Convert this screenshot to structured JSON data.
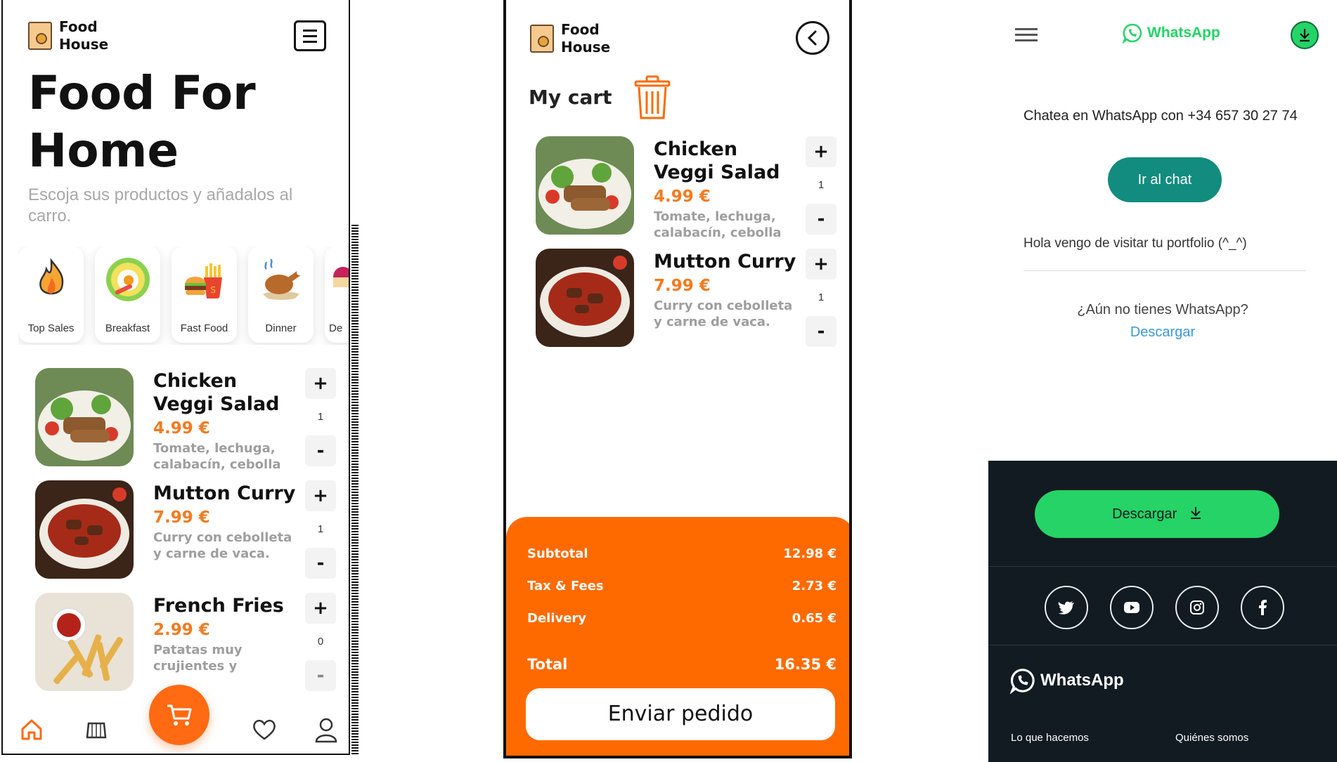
{
  "screen1": {
    "brand": {
      "line1": "Food",
      "line2": "House"
    },
    "hero": "Food For Home",
    "subtitle": "Escoja sus productos y añadalos al carro.",
    "categories": [
      {
        "label": "Top Sales",
        "icon": "fire-icon"
      },
      {
        "label": "Breakfast",
        "icon": "egg-plate-icon"
      },
      {
        "label": "Fast Food",
        "icon": "burger-fries-icon"
      },
      {
        "label": "Dinner",
        "icon": "roast-chicken-icon"
      },
      {
        "label": "De",
        "icon": "dessert-icon"
      }
    ],
    "items": [
      {
        "name": "Chicken Veggi Salad",
        "price": "4.99 €",
        "desc": "Tomate, lechuga, calabacín, cebolla y...",
        "qty": "1",
        "plus": "+",
        "minus": "-"
      },
      {
        "name": "Mutton Curry",
        "price": "7.99 €",
        "desc": "Curry con cebolleta y carne de vaca.",
        "qty": "1",
        "plus": "+",
        "minus": "-"
      },
      {
        "name": "French Fries",
        "price": "2.99 €",
        "desc": "Patatas muy crujientes y alargad...",
        "qty": "0",
        "plus": "+",
        "minus": "-"
      }
    ],
    "nav": [
      "home-icon",
      "store-icon",
      "cart-icon",
      "heart-icon",
      "user-icon"
    ],
    "accent": "#ff6a13"
  },
  "screen2": {
    "brand": {
      "line1": "Food",
      "line2": "House"
    },
    "title": "My cart",
    "items": [
      {
        "name": "Chicken Veggi Salad",
        "price": "4.99 €",
        "desc": "Tomate, lechuga, calabacín, cebolla y...",
        "qty": "1",
        "plus": "+",
        "minus": "-"
      },
      {
        "name": "Mutton Curry",
        "price": "7.99 €",
        "desc": "Curry con cebolleta y carne de vaca.",
        "qty": "1",
        "plus": "+",
        "minus": "-"
      }
    ],
    "summary": {
      "subtotal_label": "Subtotal",
      "subtotal": "12.98 €",
      "tax_label": "Tax & Fees",
      "tax": "2.73 €",
      "delivery_label": "Delivery",
      "delivery": "0.65 €",
      "total_label": "Total",
      "total": "16.35 €"
    },
    "send_label": "Enviar pedido",
    "accent": "#ff6a00"
  },
  "screen3": {
    "logo": "WhatsApp",
    "chat_with": "Chatea en WhatsApp con +34 657 30 27 74",
    "go_chat": "Ir al chat",
    "message": "Hola vengo de visitar tu portfolio (^_^)",
    "no_wa": "¿Aún no tienes WhatsApp?",
    "download_link": "Descargar",
    "download_btn": "Descargar",
    "socials": [
      "twitter-icon",
      "youtube-icon",
      "instagram-icon",
      "facebook-icon"
    ],
    "footer_logo": "WhatsApp",
    "footer_links": [
      "Lo que hacemos",
      "Quiénes somos"
    ],
    "brand_green": "#25d366"
  }
}
